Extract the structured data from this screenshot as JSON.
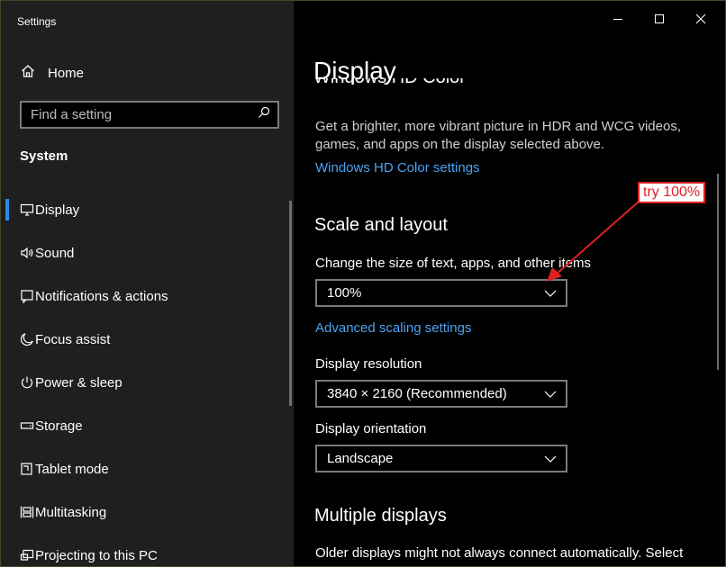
{
  "window": {
    "title": "Settings"
  },
  "sidebar": {
    "home_label": "Home",
    "search_placeholder": "Find a setting",
    "section_title": "System",
    "items": [
      {
        "label": "Display",
        "icon": "monitor-icon",
        "active": true
      },
      {
        "label": "Sound",
        "icon": "speaker-icon"
      },
      {
        "label": "Notifications & actions",
        "icon": "notifications-icon"
      },
      {
        "label": "Focus assist",
        "icon": "moon-icon"
      },
      {
        "label": "Power & sleep",
        "icon": "power-icon"
      },
      {
        "label": "Storage",
        "icon": "storage-icon"
      },
      {
        "label": "Tablet mode",
        "icon": "tablet-mode-icon"
      },
      {
        "label": "Multitasking",
        "icon": "multitasking-icon"
      },
      {
        "label": "Projecting to this PC",
        "icon": "projecting-icon"
      }
    ]
  },
  "content": {
    "page_title": "Display",
    "partially_hidden_heading": "Windows HD Color",
    "hdr_description": "Get a brighter, more vibrant picture in HDR and WCG videos, games, and apps on the display selected above.",
    "hdr_link": "Windows HD Color settings",
    "scale_heading": "Scale and layout",
    "scale_label": "Change the size of text, apps, and other items",
    "scale_value": "100%",
    "advanced_scaling_link": "Advanced scaling settings",
    "resolution_label": "Display resolution",
    "resolution_value": "3840 × 2160 (Recommended)",
    "orientation_label": "Display orientation",
    "orientation_value": "Landscape",
    "multiple_heading": "Multiple displays",
    "multiple_description": "Older displays might not always connect automatically. Select"
  },
  "annotation": {
    "text": "try 100%",
    "color": "#e02020"
  },
  "colors": {
    "accent": "#2e8ae6",
    "link": "#4ea1f3",
    "sidebar_bg": "#1f1f1f",
    "content_bg": "#000000"
  }
}
